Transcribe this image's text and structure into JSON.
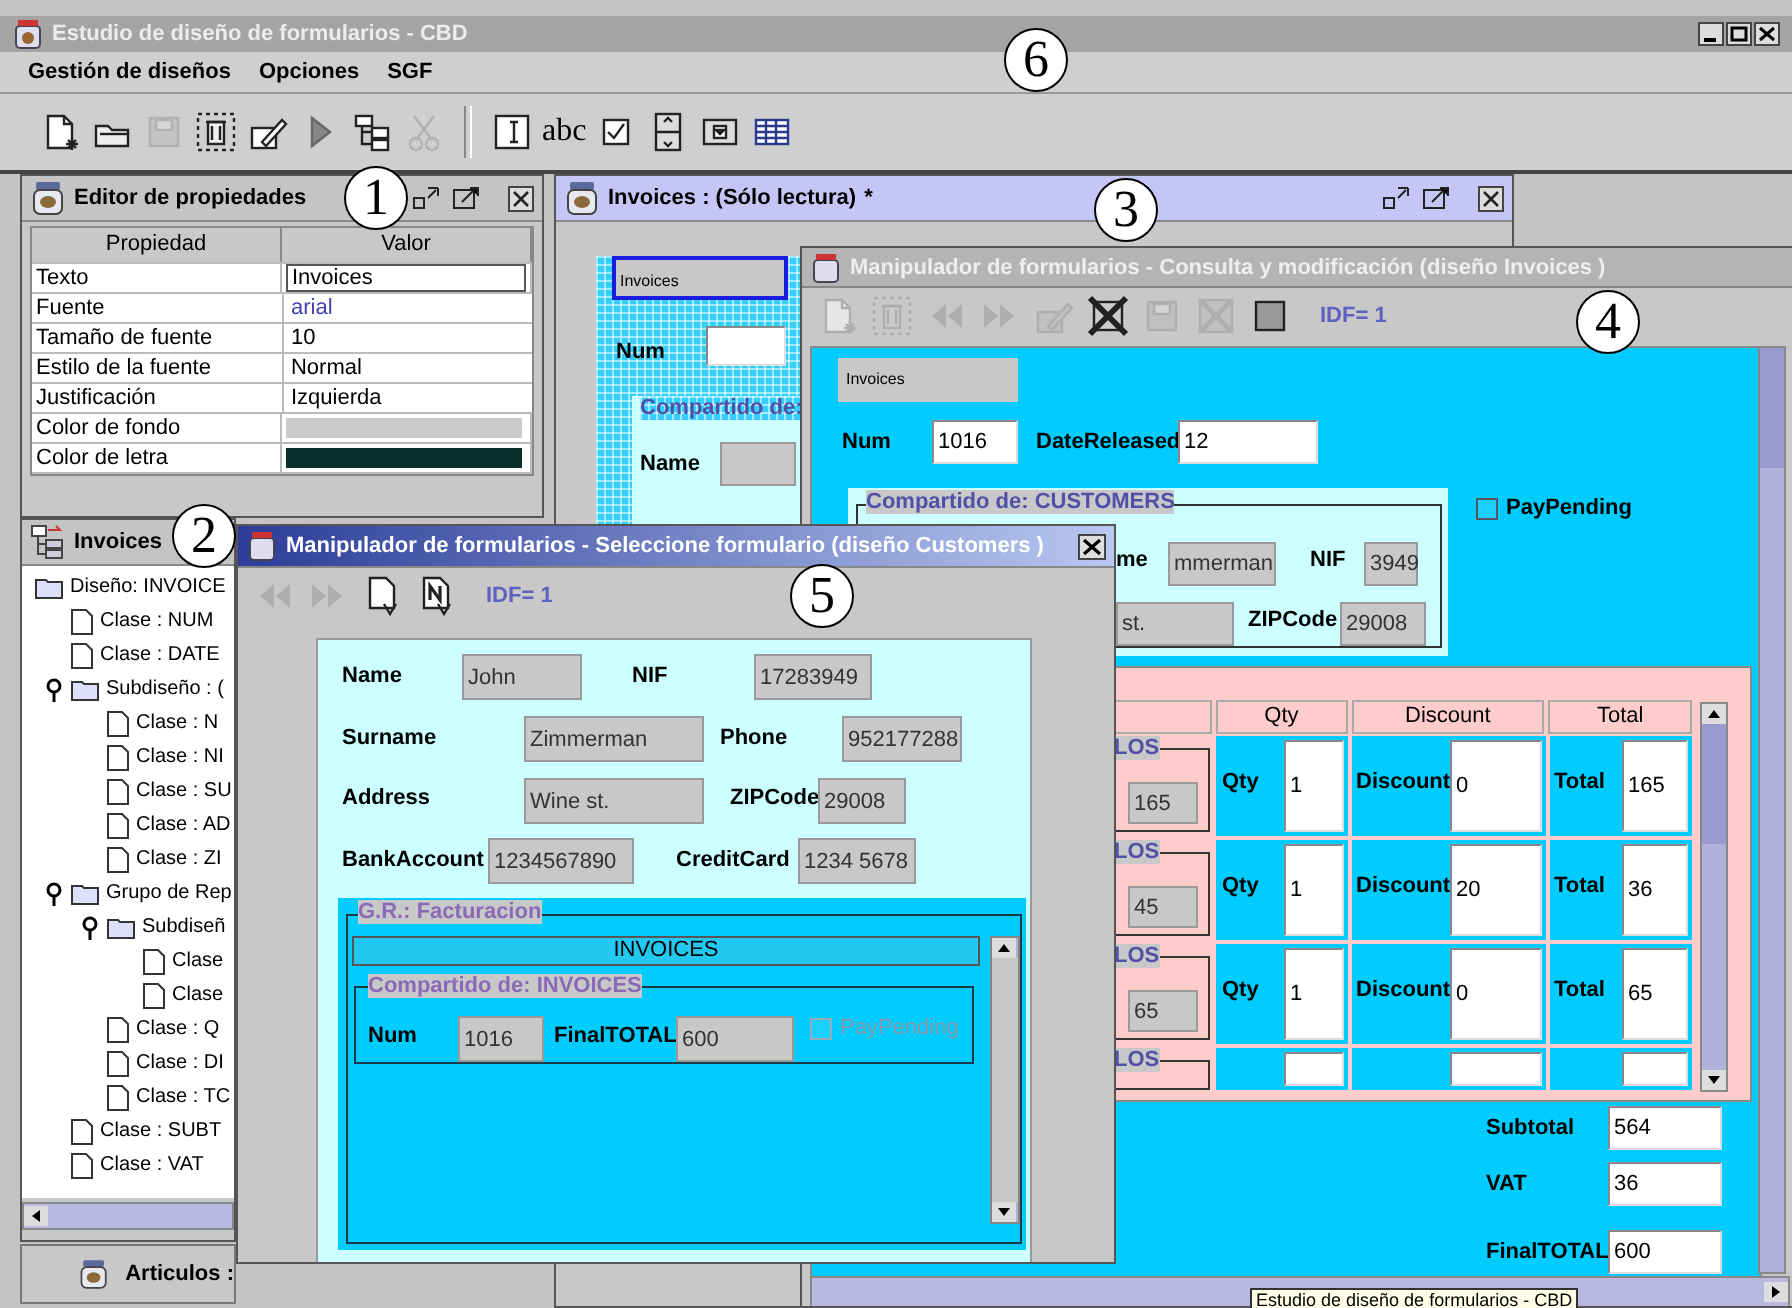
{
  "app": {
    "title": "Estudio de diseño de formularios - CBD",
    "menu": [
      {
        "label": "Gestión de diseños"
      },
      {
        "label": "Opciones"
      },
      {
        "label": "SGF"
      }
    ],
    "toolbar": [
      {
        "kind": "new",
        "disabled": false
      },
      {
        "kind": "open",
        "disabled": false
      },
      {
        "kind": "save",
        "disabled": true
      },
      {
        "kind": "delete",
        "disabled": false
      },
      {
        "kind": "edit",
        "disabled": false
      },
      {
        "kind": "run",
        "disabled": false
      },
      {
        "kind": "tree",
        "disabled": false
      },
      {
        "kind": "cut",
        "disabled": true
      },
      {
        "kind": "separator"
      },
      {
        "kind": "textfield",
        "disabled": false
      },
      {
        "kind": "label",
        "label": "abc",
        "disabled": false
      },
      {
        "kind": "checkbox",
        "disabled": false
      },
      {
        "kind": "spinner",
        "disabled": false
      },
      {
        "kind": "combo",
        "disabled": false
      },
      {
        "kind": "table",
        "disabled": false
      }
    ]
  },
  "property_editor": {
    "title": "Editor de propiedades",
    "columns": [
      "Propiedad",
      "Valor"
    ],
    "rows": [
      {
        "name": "Texto",
        "kind": "input",
        "value": "Invoices"
      },
      {
        "name": "Fuente",
        "kind": "link",
        "value": "arial"
      },
      {
        "name": "Tamaño de fuente",
        "kind": "text",
        "value": "10"
      },
      {
        "name": "Estilo de la fuente",
        "kind": "text",
        "value": "Normal"
      },
      {
        "name": "Justificación",
        "kind": "text",
        "value": "Izquierda"
      },
      {
        "name": "Color de fondo",
        "kind": "color",
        "color": "#cccccc"
      },
      {
        "name": "Color de letra",
        "kind": "color",
        "color": "#0a302c"
      }
    ]
  },
  "design_window": {
    "title": "Invoices : (Sólo lectura)",
    "title_suffix": "*",
    "tab": {
      "label": "Invoices",
      "selected": true
    },
    "num_label": "Num",
    "group_title": "Compartido de:",
    "name_label": "Name"
  },
  "tree_window": {
    "title": "Invoices",
    "items": [
      {
        "label": "Diseño: INVOICE",
        "kind": "folder",
        "children": [
          {
            "label": "Clase : NUM",
            "kind": "class"
          },
          {
            "label": "Clase : DATE",
            "kind": "class"
          },
          {
            "label": "Subdiseño : (",
            "kind": "folder",
            "expanded": true,
            "children": [
              {
                "label": "Clase : N",
                "kind": "class"
              },
              {
                "label": "Clase : NI",
                "kind": "class"
              },
              {
                "label": "Clase : SU",
                "kind": "class"
              },
              {
                "label": "Clase : AD",
                "kind": "class"
              },
              {
                "label": "Clase : ZI",
                "kind": "class"
              }
            ]
          },
          {
            "label": "Grupo de Rep",
            "kind": "folder",
            "expanded": true,
            "children": [
              {
                "label": "Subdiseñ",
                "kind": "folder",
                "expanded": true,
                "children": [
                  {
                    "label": "Clase",
                    "kind": "class"
                  },
                  {
                    "label": "Clase",
                    "kind": "class"
                  }
                ]
              },
              {
                "label": "Clase : Q",
                "kind": "class"
              },
              {
                "label": "Clase : DI",
                "kind": "class"
              },
              {
                "label": "Clase : TC",
                "kind": "class"
              }
            ]
          },
          {
            "label": "Clase : SUBT",
            "kind": "class"
          },
          {
            "label": "Clase : VAT",
            "kind": "class"
          }
        ]
      }
    ]
  },
  "minimized_window": {
    "title": "Articulos :"
  },
  "query_window": {
    "title": "Manipulador de formularios - Consulta y modificación  (diseño Invoices )",
    "toolbar": [
      {
        "kind": "new",
        "disabled": true
      },
      {
        "kind": "delete",
        "disabled": true
      },
      {
        "kind": "back",
        "disabled": true
      },
      {
        "kind": "forward",
        "disabled": true
      },
      {
        "kind": "edit",
        "disabled": true
      },
      {
        "kind": "remove",
        "disabled": false
      },
      {
        "kind": "save",
        "disabled": true
      },
      {
        "kind": "cancel",
        "disabled": true
      },
      {
        "kind": "square",
        "disabled": false
      }
    ],
    "record": "IDF= 1",
    "tab": {
      "label": "Invoices"
    },
    "fields": [
      {
        "label": "Num",
        "value": "1016",
        "readonly": false
      },
      {
        "label": "DateReleased",
        "value": "12",
        "readonly": false
      }
    ],
    "pay_pending": {
      "label": "PayPending",
      "checked": false
    },
    "customers": {
      "title": "Compartido de: CUSTOMERS",
      "items": [
        {
          "kind": "label",
          "text": "me"
        },
        {
          "kind": "field",
          "text": "mmerman",
          "readonly": true
        },
        {
          "kind": "label",
          "text": "NIF"
        },
        {
          "kind": "field",
          "text": "3949",
          "readonly": true
        },
        {
          "kind": "field",
          "text": "st.",
          "readonly": true
        },
        {
          "kind": "label",
          "text": "ZIPCode"
        },
        {
          "kind": "field",
          "text": "29008",
          "readonly": true
        }
      ]
    },
    "table": {
      "columns": [
        "Qty",
        "Discount",
        "Total"
      ],
      "rows": [
        {
          "group_title": "LOS",
          "value": "165",
          "qty_label": "Qty",
          "qty": "1",
          "discount_label": "Discount",
          "discount": "0",
          "total_label": "Total",
          "total": "165"
        },
        {
          "group_title": "LOS",
          "value": "45",
          "qty_label": "Qty",
          "qty": "1",
          "discount_label": "Discount",
          "discount": "20",
          "total_label": "Total",
          "total": "36"
        },
        {
          "group_title": "LOS",
          "value": "65",
          "qty_label": "Qty",
          "qty": "1",
          "discount_label": "Discount",
          "discount": "0",
          "total_label": "Total",
          "total": "65"
        },
        {
          "group_title": "LOS"
        }
      ]
    },
    "totals": [
      {
        "label": "Subtotal",
        "value": "564"
      },
      {
        "label": "VAT",
        "value": "36"
      },
      {
        "label": "FinalTOTAL",
        "value": "600"
      }
    ]
  },
  "select_dialog": {
    "title": "Manipulador de formularios - Seleccione formulario  (diseño Customers )",
    "toolbar": [
      {
        "kind": "back",
        "disabled": true
      },
      {
        "kind": "forward",
        "disabled": true
      },
      {
        "kind": "doc",
        "disabled": false
      },
      {
        "kind": "docn",
        "disabled": false
      }
    ],
    "record": "IDF= 1",
    "fields": [
      {
        "label": "Name",
        "value": "John"
      },
      {
        "label": "NIF",
        "value": "17283949"
      },
      {
        "label": "Surname",
        "value": "Zimmerman"
      },
      {
        "label": "Phone",
        "value": "952177288"
      },
      {
        "label": "Address",
        "value": "Wine st."
      },
      {
        "label": "ZIPCode",
        "value": "29008"
      },
      {
        "label": "BankAccount",
        "value": "1234567890"
      },
      {
        "label": "CreditCard",
        "value": "1234 5678"
      }
    ],
    "group_title": "G.R.: Facturacion",
    "list_header": "INVOICES",
    "subgroup_title": "Compartido de: INVOICES",
    "sub_fields": [
      {
        "label": "Num",
        "value": "1016"
      },
      {
        "label": "FinalTOTAL",
        "value": "600"
      }
    ],
    "pay_pending": {
      "label": "PayPending",
      "checked": false,
      "disabled": true
    }
  },
  "tooltip": "Estudio de diseño de formularios - CBD",
  "annotations": [
    {
      "label": "1"
    },
    {
      "label": "2"
    },
    {
      "label": "3"
    },
    {
      "label": "4"
    },
    {
      "label": "5"
    },
    {
      "label": "6"
    }
  ]
}
